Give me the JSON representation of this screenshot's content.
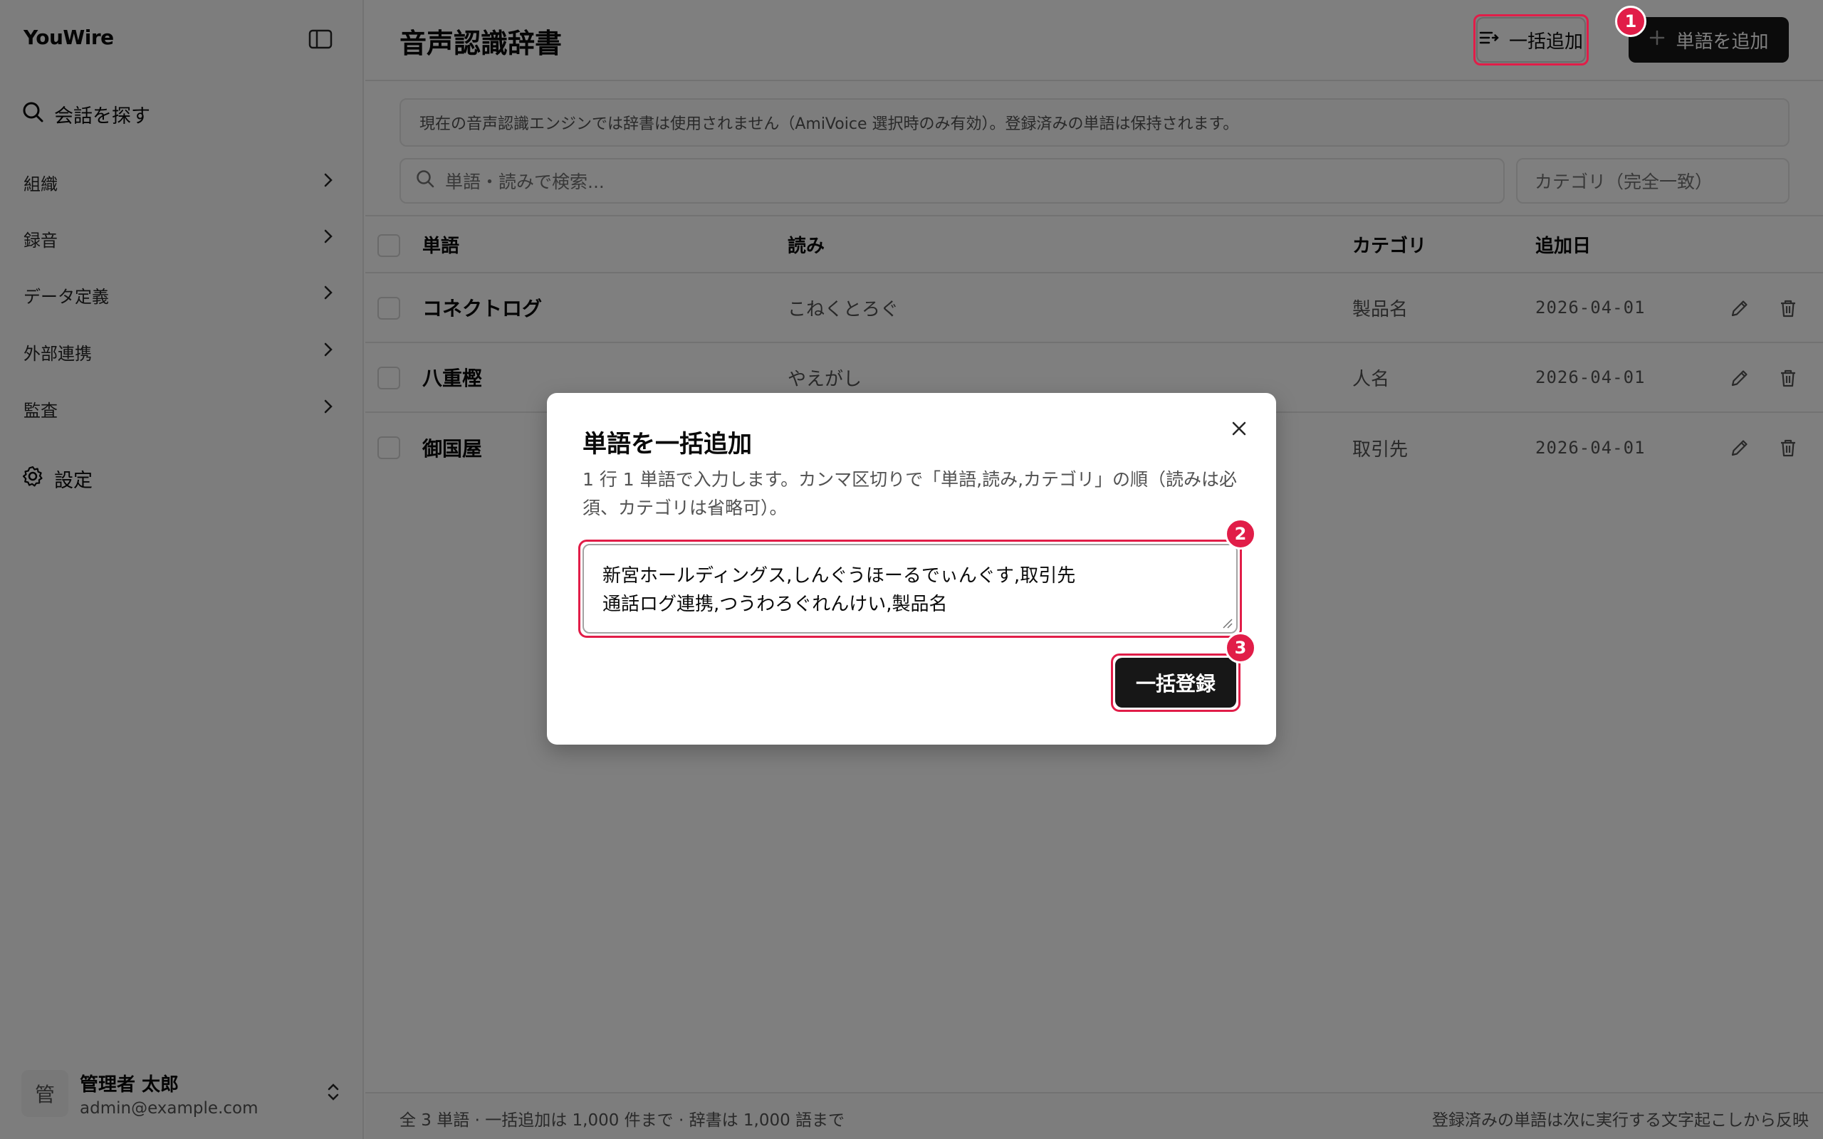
{
  "sidebar": {
    "brand": "YouWire",
    "search_label": "会話を探す",
    "items": [
      {
        "label": "組織"
      },
      {
        "label": "録音"
      },
      {
        "label": "データ定義"
      },
      {
        "label": "外部連携"
      },
      {
        "label": "監査"
      }
    ],
    "settings_label": "設定",
    "user": {
      "avatar_char": "管",
      "name": "管理者 太郎",
      "email": "admin@example.com"
    }
  },
  "header": {
    "title": "音声認識辞書",
    "bulk_add_label": "一括追加",
    "add_word_label": "単語を追加"
  },
  "notice": "現在の音声認識エンジンでは辞書は使用されません（AmiVoice 選択時のみ有効）。登録済みの単語は保持されます。",
  "filters": {
    "search_placeholder": "単語・読みで検索...",
    "category_placeholder": "カテゴリ（完全一致）"
  },
  "table": {
    "columns": [
      "単語",
      "読み",
      "カテゴリ",
      "追加日"
    ],
    "rows": [
      {
        "word": "コネクトログ",
        "reading": "こねくとろぐ",
        "category": "製品名",
        "date": "2026-04-01"
      },
      {
        "word": "八重樫",
        "reading": "やえがし",
        "category": "人名",
        "date": "2026-04-01"
      },
      {
        "word": "御国屋",
        "reading": "",
        "category": "取引先",
        "date": "2026-04-01"
      }
    ]
  },
  "footer": {
    "left": "全 3 単語 · 一括追加は 1,000 件まで · 辞書は 1,000 語まで",
    "right": "登録済みの単語は次に実行する文字起こしから反映"
  },
  "dialog": {
    "title": "単語を一括追加",
    "description": "1 行 1 単語で入力します。カンマ区切りで「単語,読み,カテゴリ」の順（読みは必須、カテゴリは省略可）。",
    "lines": [
      "新宮ホールディングス,しんぐうほーるでぃんぐす,取引先",
      "通話ログ連携,つうわろぐれんけい,製品名"
    ],
    "submit_label": "一括登録"
  },
  "annotations": {
    "badge1": "1",
    "badge2": "2",
    "badge3": "3",
    "color": "#e11d48"
  }
}
